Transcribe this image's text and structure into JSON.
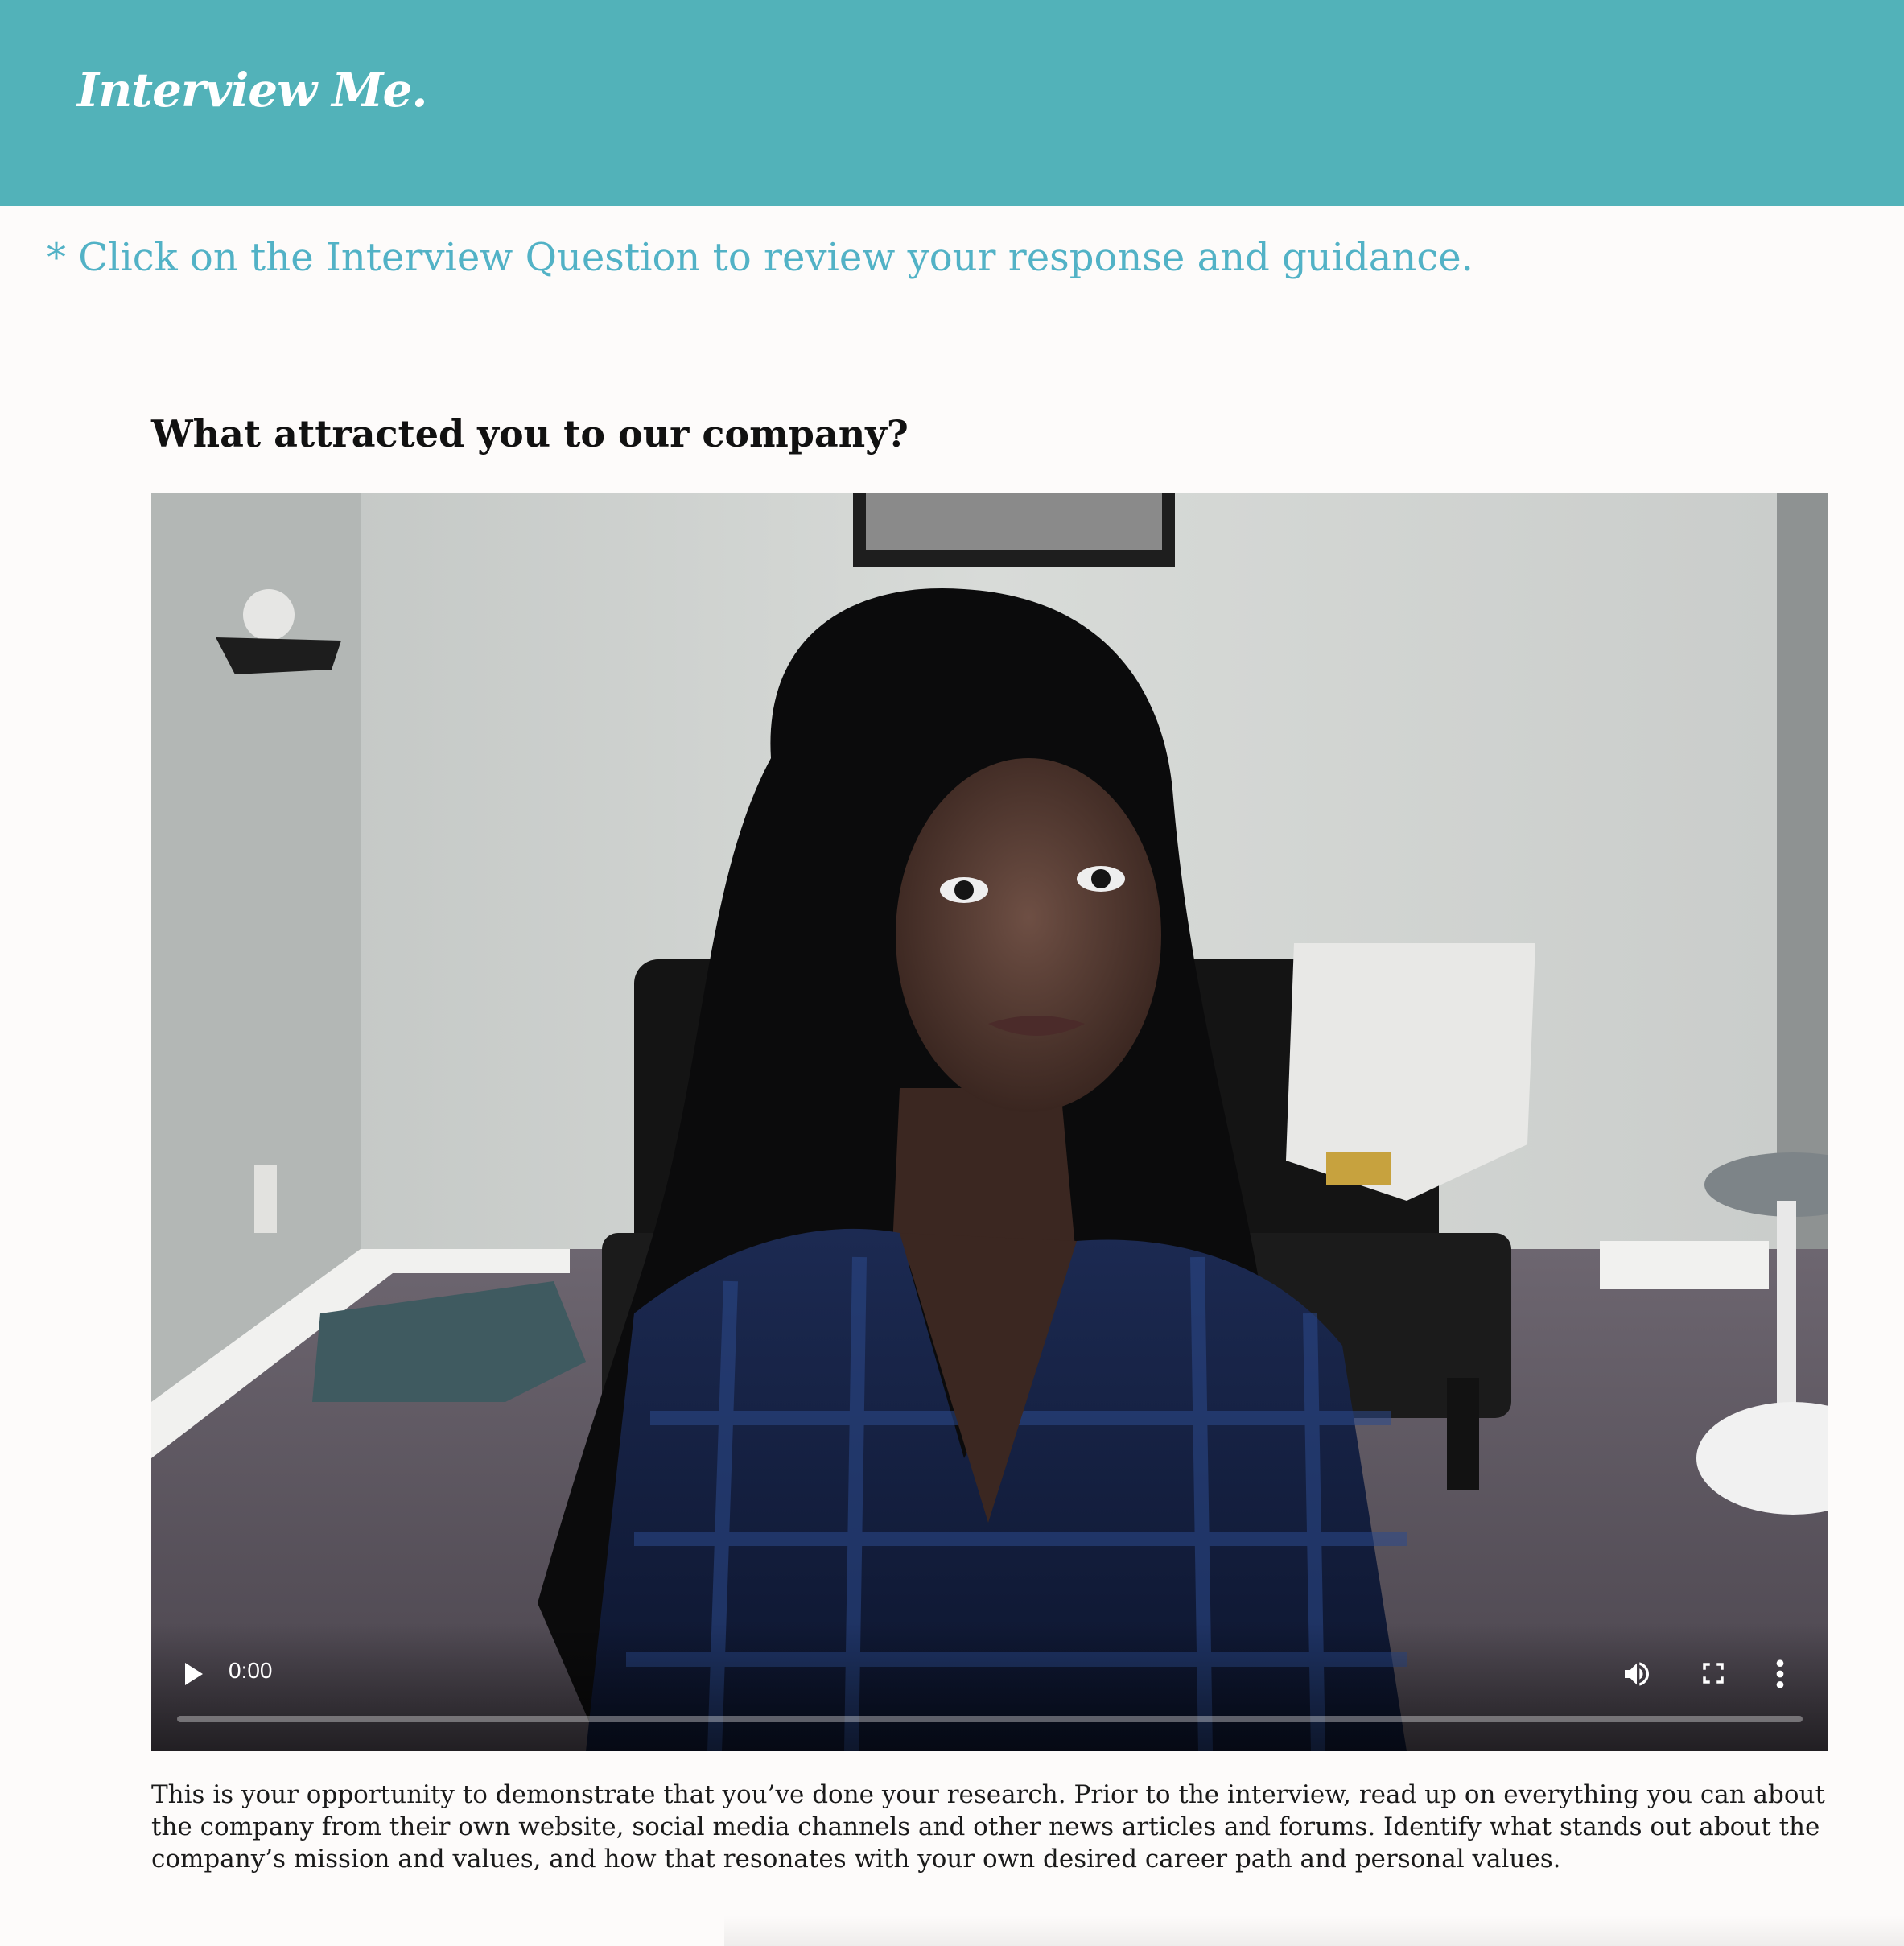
{
  "header": {
    "brand": "Interview Me.",
    "background_color": "#52b2b9"
  },
  "instruction": "* Click on the Interview Question to review your response and guidance.",
  "question": {
    "title": "What attracted you to our company?"
  },
  "video": {
    "current_time": "0:00",
    "progress": 0,
    "controls": {
      "play_icon": "play-icon",
      "volume_icon": "volume-icon",
      "fullscreen_icon": "fullscreen-icon",
      "more_icon": "more-options-icon"
    }
  },
  "guidance": "This is your opportunity to demonstrate that you’ve done your research. Prior to the interview, read up on everything you can about the company from their own website, social media channels and other news articles and forums. Identify what stands out about the company’s mission and values, and how that resonates with your own desired career path and personal values."
}
